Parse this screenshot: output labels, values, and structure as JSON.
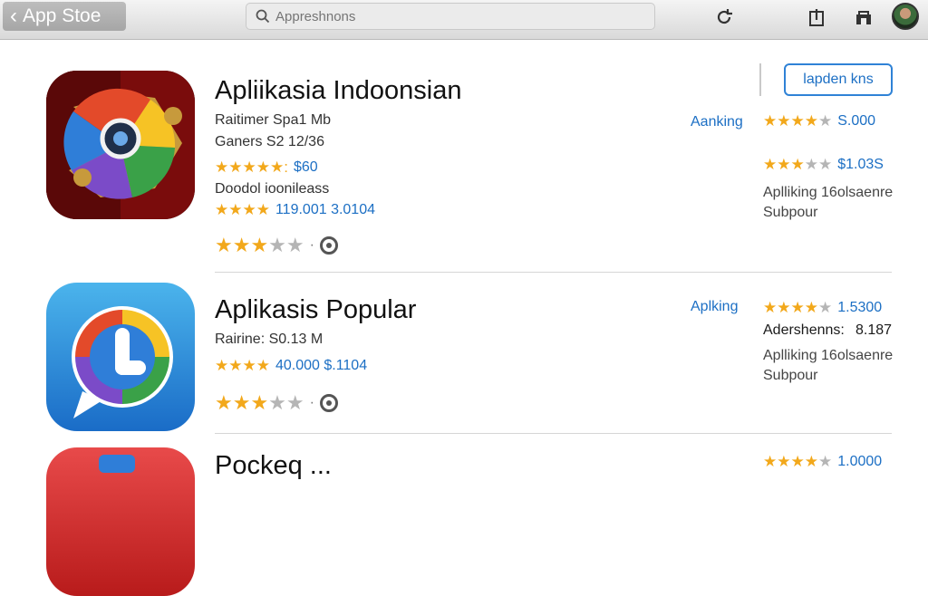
{
  "topbar": {
    "back_label": "App Stoe",
    "search_placeholder": "Appreshnons"
  },
  "action_button": "lapden kns",
  "apps": [
    {
      "title": "Apliikasia Indoonsian",
      "line1": "Raitimer Spa1 Mb",
      "line2": "Ganers S2 12/36",
      "rating_a": "$60",
      "desc": "Doodol ioonileass",
      "rating_b": "119.001 3.0104",
      "right_label": "Aanking",
      "right_val1": "S.000",
      "right_val2": "$1.03S",
      "right_text": [
        "Aplliking 16olsaenre",
        "Subpour"
      ]
    },
    {
      "title": "Aplikasis Popular",
      "line1": "Rairine: S0.13 M",
      "rating_b": "40.000 $.1104",
      "right_label": "Aplking",
      "right_val1": "1.5300",
      "right_val2_label": "Adershenns:",
      "right_val2": "8.187",
      "right_text": [
        "Aplliking 16olsaenre",
        "Subpour"
      ]
    },
    {
      "title": "Pockeq ...",
      "right_val1": "1.0000"
    }
  ],
  "colors": {
    "accent": "#1c6fc4",
    "star": "#f2a81b",
    "topbar": "#dcdcdc"
  }
}
